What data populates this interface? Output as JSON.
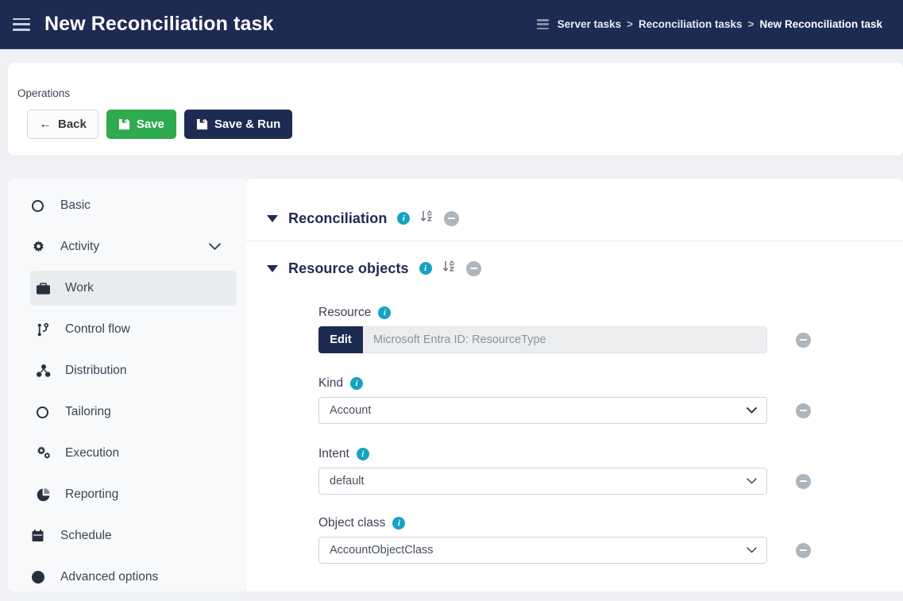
{
  "header": {
    "menu_icon": "hamburger-icon",
    "title": "New Reconciliation task",
    "breadcrumb_icon": "list-icon",
    "breadcrumb": [
      {
        "label": "Server tasks",
        "current": false
      },
      {
        "label": "Reconciliation tasks",
        "current": false
      },
      {
        "label": "New Reconciliation task",
        "current": true
      }
    ],
    "breadcrumb_separator": ">"
  },
  "operations": {
    "label": "Operations",
    "back_label": "Back",
    "back_icon": "arrow-left-icon",
    "save_label": "Save",
    "save_icon": "floppy-disk-icon",
    "save_run_label": "Save & Run",
    "save_run_icon": "floppy-disk-icon"
  },
  "sidebar": {
    "items": [
      {
        "label": "Basic",
        "icon": "circle-outline-icon",
        "sub": false,
        "active": false,
        "expandable": false
      },
      {
        "label": "Activity",
        "icon": "gear-icon",
        "sub": false,
        "active": false,
        "expandable": true
      },
      {
        "label": "Work",
        "icon": "briefcase-icon",
        "sub": true,
        "active": true,
        "expandable": false
      },
      {
        "label": "Control flow",
        "icon": "branch-icon",
        "sub": true,
        "active": false,
        "expandable": false
      },
      {
        "label": "Distribution",
        "icon": "nodes-icon",
        "sub": true,
        "active": false,
        "expandable": false
      },
      {
        "label": "Tailoring",
        "icon": "circle-outline-icon",
        "sub": true,
        "active": false,
        "expandable": false
      },
      {
        "label": "Execution",
        "icon": "gears-icon",
        "sub": true,
        "active": false,
        "expandable": false
      },
      {
        "label": "Reporting",
        "icon": "pie-chart-icon",
        "sub": true,
        "active": false,
        "expandable": false
      },
      {
        "label": "Schedule",
        "icon": "calendar-icon",
        "sub": false,
        "active": false,
        "expandable": false
      },
      {
        "label": "Advanced options",
        "icon": "circle-filled-icon",
        "sub": false,
        "active": false,
        "expandable": false
      }
    ]
  },
  "main": {
    "sections": [
      {
        "title": "Reconciliation",
        "expanded": true,
        "info_icon": "info-icon",
        "sort_icon": "sort-alpha-down-icon",
        "remove_icon": "minus-circle-icon"
      },
      {
        "title": "Resource objects",
        "expanded": true,
        "info_icon": "info-icon",
        "sort_icon": "sort-alpha-down-icon",
        "remove_icon": "minus-circle-icon"
      }
    ],
    "fields": [
      {
        "label": "Resource",
        "type": "edit-value",
        "edit_label": "Edit",
        "value": "Microsoft Entra ID: ResourceType",
        "info_icon": "info-icon",
        "remove_icon": "minus-circle-icon"
      },
      {
        "label": "Kind",
        "type": "select",
        "value": "Account",
        "info_icon": "info-icon",
        "caret_icon": "chevron-down-icon",
        "remove_icon": "minus-circle-icon"
      },
      {
        "label": "Intent",
        "type": "select",
        "value": "default",
        "info_icon": "info-icon",
        "caret_icon": "chevron-down-icon",
        "remove_icon": "minus-circle-icon"
      },
      {
        "label": "Object class",
        "type": "select",
        "value": "AccountObjectClass",
        "info_icon": "info-icon",
        "caret_icon": "chevron-down-icon",
        "remove_icon": "minus-circle-icon"
      }
    ]
  },
  "colors": {
    "header_bg": "#1d2b53",
    "page_bg": "#eff1f5",
    "save_green": "#2eaa4f",
    "info_cyan": "#17a2c2",
    "muted_gray": "#adb5bd",
    "active_item_bg": "#e9ecef"
  }
}
